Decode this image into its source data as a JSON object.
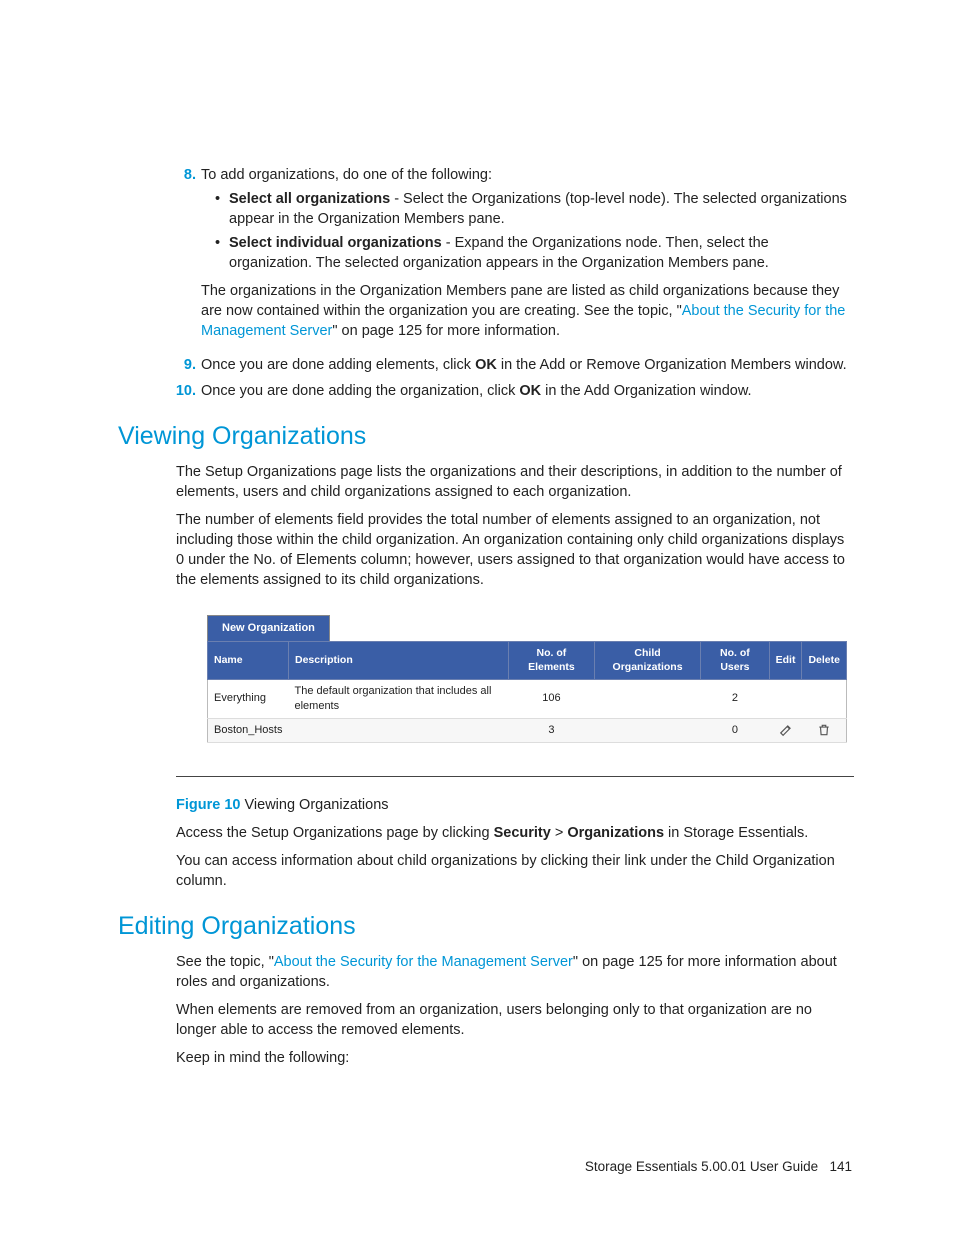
{
  "list": {
    "item8": {
      "num": "8.",
      "intro": "To add organizations, do one of the following:",
      "b1_bold": "Select all organizations",
      "b1_rest": "  - Select the Organizations (top-level node). The selected organizations appear in the Organization Members pane.",
      "b2_bold": "Select individual organizations",
      "b2_rest": "  - Expand the Organizations node. Then, select the organization. The selected organization appears in the Organization Members pane.",
      "trail1": "The organizations in the Organization Members pane are listed as child organizations because they are now contained within the organization you are creating. See the topic, \"",
      "trail_link": "About the Security for the Management Server",
      "trail2": "\" on page 125 for more information."
    },
    "item9": {
      "num": "9.",
      "t1": "Once you are done adding elements, click ",
      "bold": "OK",
      "t2": " in the Add or Remove Organization Members window."
    },
    "item10": {
      "num": "10.",
      "t1": "Once you are done adding the organization, click ",
      "bold": "OK",
      "t2": " in the Add Organization window."
    }
  },
  "viewing": {
    "heading": "Viewing Organizations",
    "p1": "The Setup Organizations page lists the organizations and their descriptions, in addition to the number of elements, users and child organizations assigned to each organization.",
    "p2": "The number of elements field provides the total number of elements assigned to an organization, not including those within the child organization. An organization containing only child organizations displays 0 under the No. of Elements column; however, users assigned to that organization would have access to the elements assigned to its child organizations."
  },
  "shot": {
    "tab": "New Organization",
    "headers": {
      "name": "Name",
      "desc": "Description",
      "elems": "No. of Elements",
      "childs": "Child Organizations",
      "users": "No. of Users",
      "edit": "Edit",
      "delete": "Delete"
    },
    "rows": [
      {
        "name": "Everything",
        "desc": "The default organization that includes all elements",
        "elems": "106",
        "childs": "",
        "users": "2",
        "edit": false,
        "delete": false
      },
      {
        "name": "Boston_Hosts",
        "desc": "",
        "elems": "3",
        "childs": "",
        "users": "0",
        "edit": true,
        "delete": true
      }
    ]
  },
  "figure": {
    "label": "Figure 10",
    "caption": " Viewing Organizations"
  },
  "viewing2": {
    "p3a": "Access the Setup Organizations page by clicking ",
    "p3b": "Security",
    "p3c": " > ",
    "p3d": "Organizations",
    "p3e": " in Storage Essentials.",
    "p4": "You can access information about child organizations by clicking their link under the Child Organization column."
  },
  "editing": {
    "heading": "Editing Organizations",
    "p1a": "See the topic, \"",
    "p1link": "About the Security for the Management Server",
    "p1b": "\" on page 125 for more information about roles and organizations.",
    "p2": "When elements are removed from an organization, users belonging only to that organization are no longer able to access the removed elements.",
    "p3": "Keep in mind the following:"
  },
  "footer": {
    "text": "Storage Essentials 5.00.01 User Guide",
    "page": "141"
  }
}
